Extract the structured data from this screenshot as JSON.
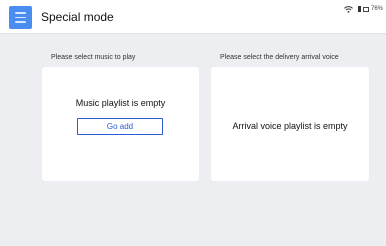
{
  "header": {
    "title": "Special mode",
    "menu_icon": "menu-icon",
    "status": {
      "wifi_icon": "wifi-icon",
      "signal_icon": "signal-icon",
      "battery_icon": "battery-icon",
      "battery_text": "76%"
    }
  },
  "music": {
    "section_label": "Please select music to play",
    "empty_text": "Music playlist is empty",
    "add_button": "Go add"
  },
  "voice": {
    "section_label": "Please select the delivery arrival voice",
    "empty_text": "Arrival voice playlist is empty"
  },
  "colors": {
    "accent": "#4a8df0",
    "button_border": "#2b5bd7",
    "background": "#eceef1",
    "card": "#ffffff"
  }
}
